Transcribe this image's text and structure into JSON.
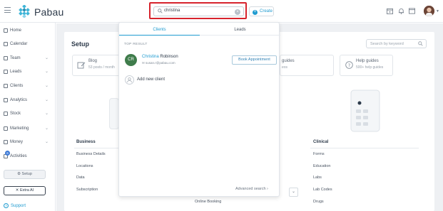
{
  "brand": {
    "name": "Pabau",
    "accent": "#1f9bd0",
    "highlight_color": "#d7232c"
  },
  "header": {
    "search_value": "christina",
    "create_label": "Create",
    "icons": [
      "calendar-icon",
      "bell-icon",
      "window-icon",
      "user-avatar"
    ]
  },
  "sidebar": {
    "items": [
      {
        "label": "Home",
        "icon": "home-icon",
        "has_chevron": false
      },
      {
        "label": "Calendar",
        "icon": "calendar-icon",
        "has_chevron": false
      },
      {
        "label": "Team",
        "icon": "team-icon",
        "has_chevron": true
      },
      {
        "label": "Leads",
        "icon": "leads-icon",
        "has_chevron": true
      },
      {
        "label": "Clients",
        "icon": "clients-icon",
        "has_chevron": true
      },
      {
        "label": "Analytics",
        "icon": "analytics-icon",
        "has_chevron": true
      },
      {
        "label": "Stock",
        "icon": "stock-icon",
        "has_chevron": true
      },
      {
        "label": "Marketing",
        "icon": "marketing-icon",
        "has_chevron": true
      },
      {
        "label": "Money",
        "icon": "money-icon",
        "has_chevron": true
      },
      {
        "label": "Activities",
        "icon": "activities-icon",
        "has_chevron": false
      }
    ],
    "activities_badge": "6",
    "setup_label": "Setup",
    "extra_ai_label": "Extra AI",
    "support_label": "Support"
  },
  "setup": {
    "title": "Setup",
    "search_placeholder": "Search by keyword",
    "cards": [
      {
        "title": "Blog",
        "subtitle": "53 posts / month"
      },
      {
        "title": "guides",
        "subtitle": "eos"
      },
      {
        "title": "Help guides",
        "subtitle": "500+ help guides"
      }
    ],
    "columns": [
      {
        "heading": "Business",
        "items": [
          "Business Details",
          "Locations",
          "Data",
          "Subscription"
        ]
      },
      {
        "heading": "",
        "items": [
          "Online Booking"
        ]
      },
      {
        "heading": "Clinical",
        "items": [
          "Forms",
          "Education",
          "Labs",
          "Lab Codes",
          "Drugs"
        ]
      }
    ]
  },
  "search_dropdown": {
    "tabs": [
      {
        "label": "Clients",
        "active": true
      },
      {
        "label": "Leads",
        "active": false
      }
    ],
    "section_label": "TOP RESULT",
    "result": {
      "initials": "CR",
      "first_name": "Christina",
      "last_name": " Robinson",
      "email": "susan.r@pabau.com"
    },
    "book_label": "Book Appointment",
    "add_client_label": "Add new client",
    "advanced_label": "Advanced search"
  }
}
